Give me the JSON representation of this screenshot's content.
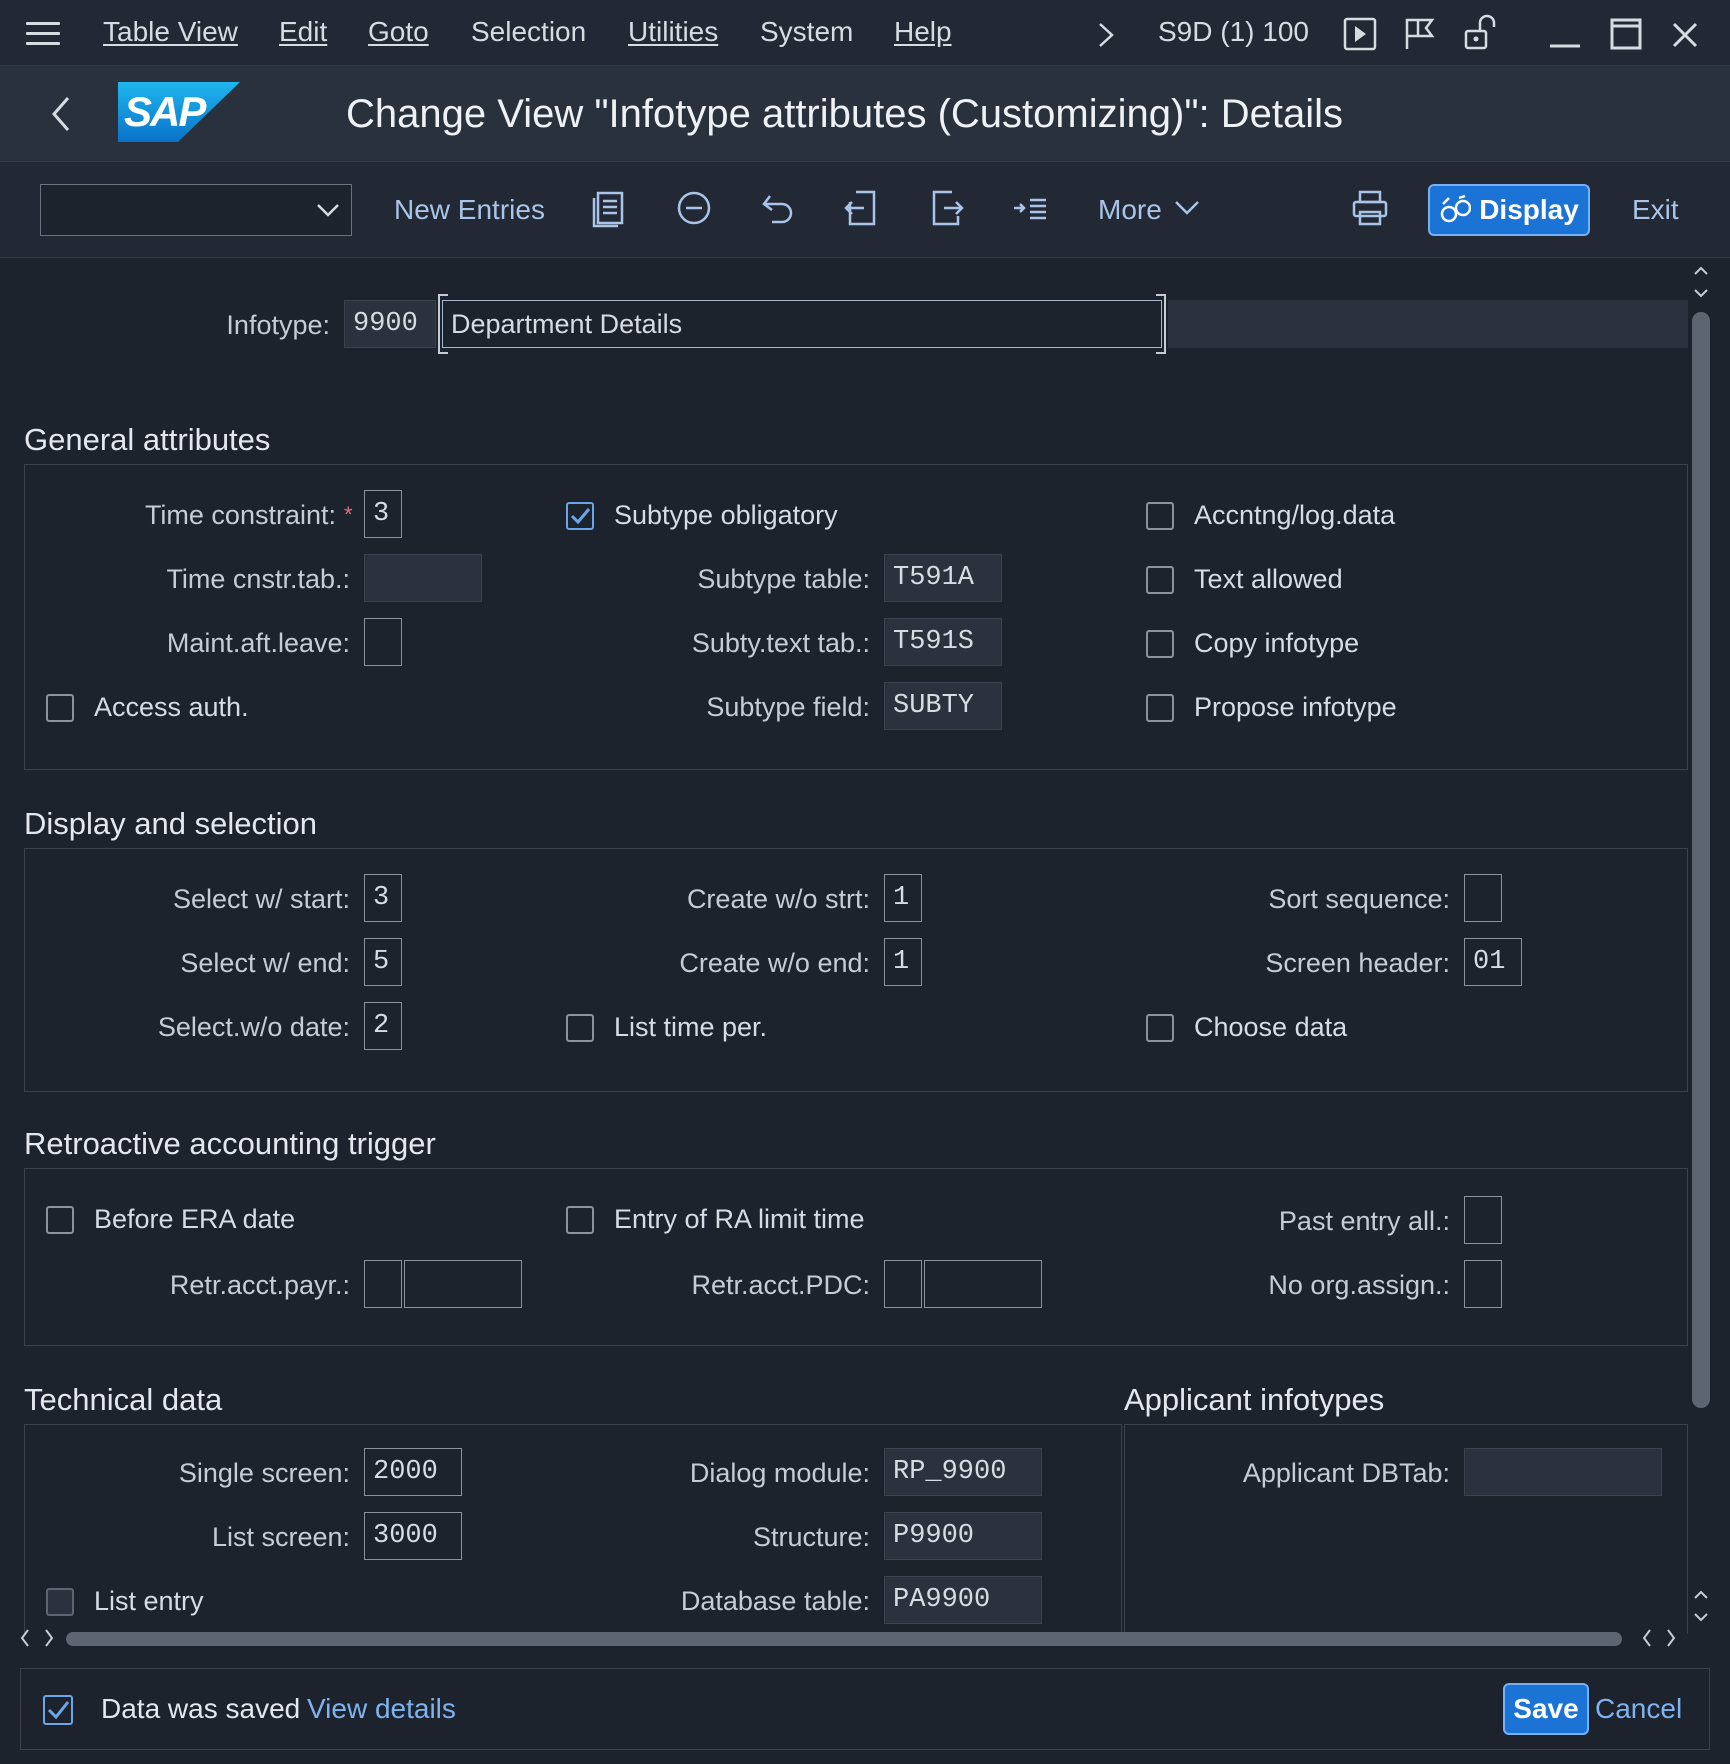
{
  "menubar": {
    "items": [
      "Table View",
      "Edit",
      "Goto",
      "Selection",
      "Utilities",
      "System",
      "Help"
    ],
    "system_info": "S9D (1) 100"
  },
  "titlebar": {
    "logo_text": "SAP",
    "title": "Change View \"Infotype attributes (Customizing)\": Details"
  },
  "toolbar": {
    "select_value": "",
    "new_entries": "New Entries",
    "more": "More",
    "display": "Display",
    "exit": "Exit"
  },
  "header": {
    "infotype_label": "Infotype:",
    "infotype_number": "9900",
    "infotype_name": "Department Details"
  },
  "general": {
    "title": "General attributes",
    "time_constraint_label": "Time constraint:",
    "time_constraint_required": "*",
    "time_constraint": "3",
    "time_cnstr_tab_label": "Time cnstr.tab.:",
    "time_cnstr_tab": "",
    "maint_aft_leave_label": "Maint.aft.leave:",
    "maint_aft_leave": "",
    "access_auth": {
      "label": "Access auth.",
      "checked": false
    },
    "subtype_obligatory": {
      "label": "Subtype obligatory",
      "checked": true
    },
    "subtype_table_label": "Subtype table:",
    "subtype_table": "T591A",
    "subty_text_tab_label": "Subty.text tab.:",
    "subty_text_tab": "T591S",
    "subtype_field_label": "Subtype field:",
    "subtype_field": "SUBTY",
    "accntng_log_data": {
      "label": "Accntng/log.data",
      "checked": false
    },
    "text_allowed": {
      "label": "Text allowed",
      "checked": false
    },
    "copy_infotype": {
      "label": "Copy infotype",
      "checked": false
    },
    "propose_infotype": {
      "label": "Propose infotype",
      "checked": false
    }
  },
  "display_selection": {
    "title": "Display and selection",
    "select_w_start_label": "Select w/ start:",
    "select_w_start": "3",
    "select_w_end_label": "Select w/ end:",
    "select_w_end": "5",
    "select_wo_date_label": "Select.w/o date:",
    "select_wo_date": "2",
    "create_wo_strt_label": "Create w/o strt:",
    "create_wo_strt": "1",
    "create_wo_end_label": "Create w/o end:",
    "create_wo_end": "1",
    "list_time_per": {
      "label": "List time per.",
      "checked": false
    },
    "sort_sequence_label": "Sort sequence:",
    "sort_sequence": "",
    "screen_header_label": "Screen header:",
    "screen_header": "01",
    "choose_data": {
      "label": "Choose data",
      "checked": false
    }
  },
  "retro": {
    "title": "Retroactive accounting trigger",
    "before_era_date": {
      "label": "Before ERA date",
      "checked": false
    },
    "entry_of_ra_limit_time": {
      "label": "Entry of RA limit time",
      "checked": false
    },
    "retr_acct_payr_label": "Retr.acct.payr.:",
    "retr_acct_pdc_label": "Retr.acct.PDC:",
    "past_entry_all_label": "Past entry all.:",
    "no_org_assign_label": "No org.assign.:"
  },
  "technical": {
    "title": "Technical data",
    "single_screen_label": "Single screen:",
    "single_screen": "2000",
    "list_screen_label": "List screen:",
    "list_screen": "3000",
    "list_entry": {
      "label": "List entry",
      "checked": false
    },
    "dialog_module_label": "Dialog module:",
    "dialog_module": "RP_9900",
    "structure_label": "Structure:",
    "structure": "P9900",
    "database_table_label": "Database table:",
    "database_table": "PA9900"
  },
  "applicant": {
    "title": "Applicant infotypes",
    "applicant_dbtab_label": "Applicant DBTab:",
    "applicant_dbtab": ""
  },
  "footer": {
    "status_text": "Data was saved",
    "view_details": "View details",
    "save": "Save",
    "cancel": "Cancel"
  },
  "colors": {
    "background": "#1d232d",
    "accent": "#1b73d6",
    "link": "#7fb3ef"
  }
}
